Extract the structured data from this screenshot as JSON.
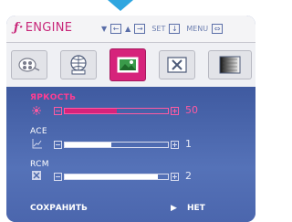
{
  "header": {
    "brand": "ENGINE",
    "set_label": "SET",
    "menu_label": "MENU"
  },
  "tabs": [
    {
      "name": "color-tab"
    },
    {
      "name": "display-tab"
    },
    {
      "name": "picture-tab",
      "active": true
    },
    {
      "name": "close-tab"
    },
    {
      "name": "contrast-tab"
    }
  ],
  "settings": [
    {
      "label": "ЯРКОСТЬ",
      "value": "50",
      "level": 0.5,
      "icon": "brightness-icon"
    },
    {
      "label": "ACE",
      "value": "1",
      "level": 0.45,
      "icon": "ace-icon"
    },
    {
      "label": "RCM",
      "value": "2",
      "level": 0.9,
      "icon": "rcm-icon"
    }
  ],
  "footer": {
    "save_label": "СОХРАНИТЬ",
    "save_value": "НЕТ"
  },
  "colors": {
    "accent": "#d6237b",
    "panel": "#4a66a9",
    "pointer": "#2fa6e0"
  }
}
